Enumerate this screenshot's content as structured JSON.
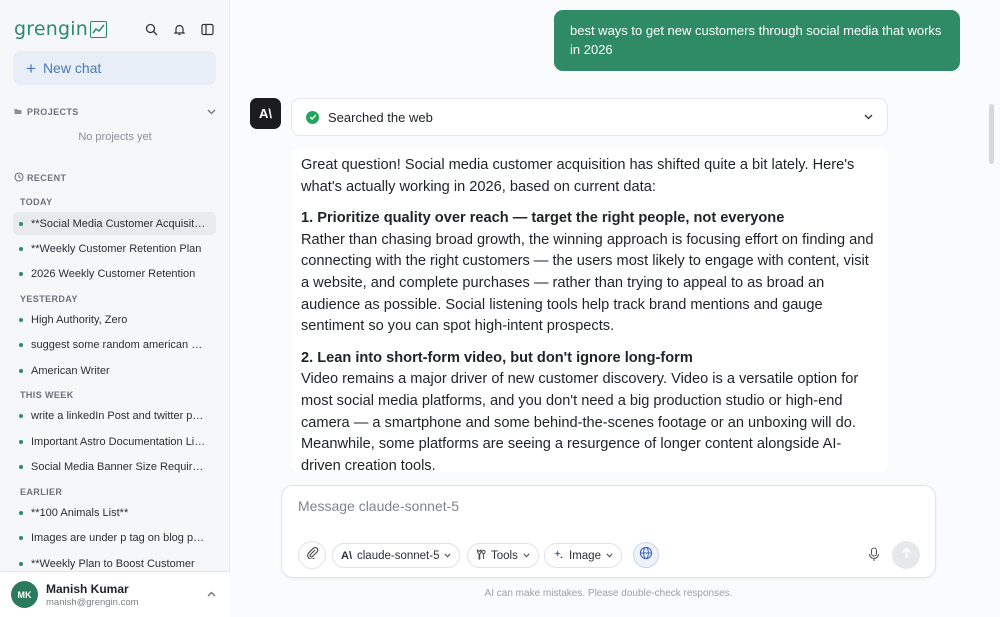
{
  "app": {
    "logo_text": "grengin"
  },
  "sidebar": {
    "new_chat_label": "New chat",
    "projects_label": "PROJECTS",
    "projects_empty": "No projects yet",
    "recent_label": "RECENT",
    "groups": [
      {
        "label": "TODAY",
        "items": [
          "**Social Media Customer Acquisition",
          "**Weekly Customer Retention Plan",
          "2026 Weekly Customer Retention"
        ]
      },
      {
        "label": "YESTERDAY",
        "items": [
          "High Authority, Zero",
          "suggest some random american names",
          "American Writer"
        ]
      },
      {
        "label": "THIS WEEK",
        "items": [
          "write a linkedIn Post and twitter post",
          "Important Astro Documentation Links",
          "Social Media Banner Size Requirements"
        ]
      },
      {
        "label": "EARLIER",
        "items": [
          "**100 Animals List**",
          "Images are under p tag on blog posts",
          "**Weekly Plan to Boost Customer"
        ]
      }
    ],
    "user": {
      "initials": "MK",
      "name": "Manish Kumar",
      "email": "manish@grengin.com"
    }
  },
  "conversation": {
    "user_message": "best ways to get new customers through social media that works in 2026",
    "assistant_avatar": "A\\",
    "tool_status": "Searched the web",
    "response": {
      "intro": "Great question! Social media customer acquisition has shifted quite a bit lately. Here's what's actually working in 2026, based on current data:",
      "points": [
        {
          "heading": "1. Prioritize quality over reach — target the right people, not everyone",
          "body": "Rather than chasing broad growth, the winning approach is focusing effort on finding and connecting with the right customers — the users most likely to engage with content, visit a website, and complete purchases — rather than trying to appeal to as broad an audience as possible. Social listening tools help track brand mentions and gauge sentiment so you can spot high-intent prospects."
        },
        {
          "heading": "2. Lean into short-form video, but don't ignore long-form",
          "body": "Video remains a major driver of new customer discovery. Video is a versatile option for most social media platforms, and you don't need a big production studio or high-end camera — a smartphone and some behind-the-scenes footage or an unboxing will do. Meanwhile, some platforms are seeing a resurgence of longer content alongside AI-driven creation tools."
        }
      ]
    }
  },
  "composer": {
    "placeholder": "Message claude-sonnet-5",
    "model_label": "claude-sonnet-5",
    "tools_label": "Tools",
    "image_label": "Image",
    "disclaimer": "AI can make mistakes. Please double-check responses."
  },
  "colors": {
    "brand": "#2c8a6a",
    "user_bubble": "#2f8a66",
    "new_chat_bg": "#e7eef7",
    "new_chat_text": "#4a78b5"
  }
}
